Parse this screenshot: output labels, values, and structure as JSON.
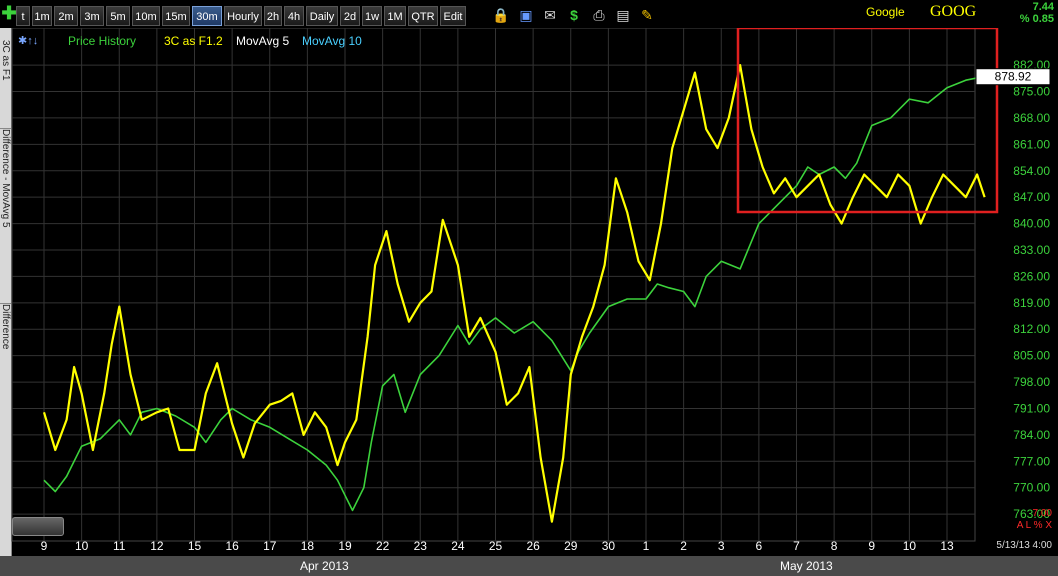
{
  "toolbar": {
    "buttons": [
      "t",
      "1m",
      "2m",
      "3m",
      "5m",
      "10m",
      "15m",
      "30m",
      "Hourly",
      "2h",
      "4h",
      "Daily",
      "2d",
      "1w",
      "1M",
      "QTR",
      "Edit"
    ],
    "active": "30m",
    "icons": [
      "lock-icon",
      "save-icon",
      "mail-icon",
      "dollar-icon",
      "print-icon",
      "card-icon",
      "pencil-icon"
    ],
    "plus_icon": "plus-icon"
  },
  "header": {
    "company": "Google",
    "symbol": "GOOG",
    "change": "7.44",
    "change_pct": "% 0.85"
  },
  "left_panel": {
    "tabs": [
      "3C as F1",
      "Difference - MovAvg 5",
      "Difference"
    ]
  },
  "legend": {
    "items": [
      {
        "label": "Price History",
        "color": "#3cd23c"
      },
      {
        "label": "3C as F1.2",
        "color": "#ffff00"
      },
      {
        "label": "MovAvg 5",
        "color": "#ffffff"
      },
      {
        "label": "MovAvg 10",
        "color": "#4ad0ff"
      }
    ]
  },
  "axis_bottom_info": {
    "value": "7.00",
    "flags": "A L % X",
    "datetime": "5/13/13 4:00"
  },
  "footer": {
    "months": [
      "Apr 2013",
      "May 2013"
    ]
  },
  "chart_data": {
    "type": "line",
    "price_label": "878.92",
    "x_ticks": [
      "9",
      "10",
      "11",
      "12",
      "15",
      "16",
      "17",
      "18",
      "19",
      "22",
      "23",
      "24",
      "25",
      "26",
      "29",
      "30",
      "1",
      "2",
      "3",
      "6",
      "7",
      "8",
      "9",
      "10",
      "13"
    ],
    "y_ticks": [
      882,
      875,
      868,
      861,
      854,
      847,
      840,
      833,
      826,
      819,
      812,
      805,
      798,
      791,
      784,
      777,
      770,
      763
    ],
    "ylim": [
      758,
      886
    ],
    "grid": true,
    "series": [
      {
        "name": "Price History",
        "color": "#3cd23c",
        "points": [
          [
            0,
            772
          ],
          [
            0.3,
            769
          ],
          [
            0.6,
            773
          ],
          [
            1,
            781
          ],
          [
            1.5,
            783
          ],
          [
            2,
            788
          ],
          [
            2.3,
            784
          ],
          [
            2.6,
            790
          ],
          [
            3,
            791
          ],
          [
            3.5,
            789
          ],
          [
            4,
            786
          ],
          [
            4.3,
            782
          ],
          [
            4.7,
            788
          ],
          [
            5,
            791
          ],
          [
            5.5,
            788
          ],
          [
            6,
            786
          ],
          [
            6.5,
            783
          ],
          [
            7,
            780
          ],
          [
            7.5,
            776
          ],
          [
            7.8,
            772
          ],
          [
            8,
            768
          ],
          [
            8.2,
            764
          ],
          [
            8.5,
            770
          ],
          [
            8.7,
            782
          ],
          [
            9,
            797
          ],
          [
            9.3,
            800
          ],
          [
            9.6,
            790
          ],
          [
            10,
            800
          ],
          [
            10.5,
            805
          ],
          [
            11,
            813
          ],
          [
            11.3,
            808
          ],
          [
            11.6,
            812
          ],
          [
            12,
            815
          ],
          [
            12.5,
            811
          ],
          [
            13,
            814
          ],
          [
            13.5,
            809
          ],
          [
            14,
            801
          ],
          [
            14.2,
            806
          ],
          [
            14.5,
            811
          ],
          [
            15,
            818
          ],
          [
            15.5,
            820
          ],
          [
            16,
            820
          ],
          [
            16.3,
            824
          ],
          [
            16.6,
            823
          ],
          [
            17,
            822
          ],
          [
            17.3,
            818
          ],
          [
            17.6,
            826
          ],
          [
            18,
            830
          ],
          [
            18.5,
            828
          ],
          [
            19,
            840
          ],
          [
            19.5,
            845
          ],
          [
            20,
            850
          ],
          [
            20.3,
            855
          ],
          [
            20.6,
            853
          ],
          [
            21,
            855
          ],
          [
            21.3,
            852
          ],
          [
            21.6,
            856
          ],
          [
            22,
            866
          ],
          [
            22.5,
            868
          ],
          [
            23,
            873
          ],
          [
            23.5,
            872
          ],
          [
            24,
            876
          ],
          [
            24.5,
            878
          ],
          [
            25,
            879
          ]
        ]
      },
      {
        "name": "3C as F1.2",
        "color": "#ffff00",
        "points": [
          [
            0,
            790
          ],
          [
            0.3,
            780
          ],
          [
            0.6,
            788
          ],
          [
            0.8,
            802
          ],
          [
            1,
            795
          ],
          [
            1.3,
            780
          ],
          [
            1.6,
            795
          ],
          [
            1.8,
            808
          ],
          [
            2,
            818
          ],
          [
            2.3,
            800
          ],
          [
            2.6,
            788
          ],
          [
            3,
            790
          ],
          [
            3.3,
            791
          ],
          [
            3.6,
            780
          ],
          [
            4,
            780
          ],
          [
            4.3,
            795
          ],
          [
            4.6,
            803
          ],
          [
            5,
            787
          ],
          [
            5.3,
            778
          ],
          [
            5.6,
            787
          ],
          [
            6,
            792
          ],
          [
            6.3,
            793
          ],
          [
            6.6,
            795
          ],
          [
            6.9,
            784
          ],
          [
            7.2,
            790
          ],
          [
            7.5,
            786
          ],
          [
            7.8,
            776
          ],
          [
            8,
            782
          ],
          [
            8.3,
            788
          ],
          [
            8.6,
            810
          ],
          [
            8.8,
            829
          ],
          [
            9.1,
            838
          ],
          [
            9.4,
            824
          ],
          [
            9.7,
            814
          ],
          [
            10,
            819
          ],
          [
            10.3,
            822
          ],
          [
            10.6,
            841
          ],
          [
            11,
            829
          ],
          [
            11.3,
            810
          ],
          [
            11.6,
            815
          ],
          [
            12,
            806
          ],
          [
            12.3,
            792
          ],
          [
            12.6,
            795
          ],
          [
            12.9,
            802
          ],
          [
            13.2,
            778
          ],
          [
            13.5,
            761
          ],
          [
            13.8,
            778
          ],
          [
            14,
            800
          ],
          [
            14.3,
            810
          ],
          [
            14.6,
            818
          ],
          [
            14.9,
            829
          ],
          [
            15.2,
            852
          ],
          [
            15.5,
            843
          ],
          [
            15.8,
            830
          ],
          [
            16.1,
            825
          ],
          [
            16.4,
            840
          ],
          [
            16.7,
            860
          ],
          [
            17,
            870
          ],
          [
            17.3,
            880
          ],
          [
            17.6,
            865
          ],
          [
            17.9,
            860
          ],
          [
            18.2,
            868
          ],
          [
            18.5,
            882
          ],
          [
            18.8,
            865
          ],
          [
            19.1,
            855
          ],
          [
            19.4,
            848
          ],
          [
            19.7,
            852
          ],
          [
            20,
            847
          ],
          [
            20.3,
            850
          ],
          [
            20.6,
            853
          ],
          [
            20.9,
            845
          ],
          [
            21.2,
            840
          ],
          [
            21.5,
            847
          ],
          [
            21.8,
            853
          ],
          [
            22.1,
            850
          ],
          [
            22.4,
            847
          ],
          [
            22.7,
            853
          ],
          [
            23,
            850
          ],
          [
            23.3,
            840
          ],
          [
            23.6,
            847
          ],
          [
            23.9,
            853
          ],
          [
            24.2,
            850
          ],
          [
            24.5,
            847
          ],
          [
            24.8,
            853
          ],
          [
            25,
            847
          ]
        ]
      }
    ]
  }
}
